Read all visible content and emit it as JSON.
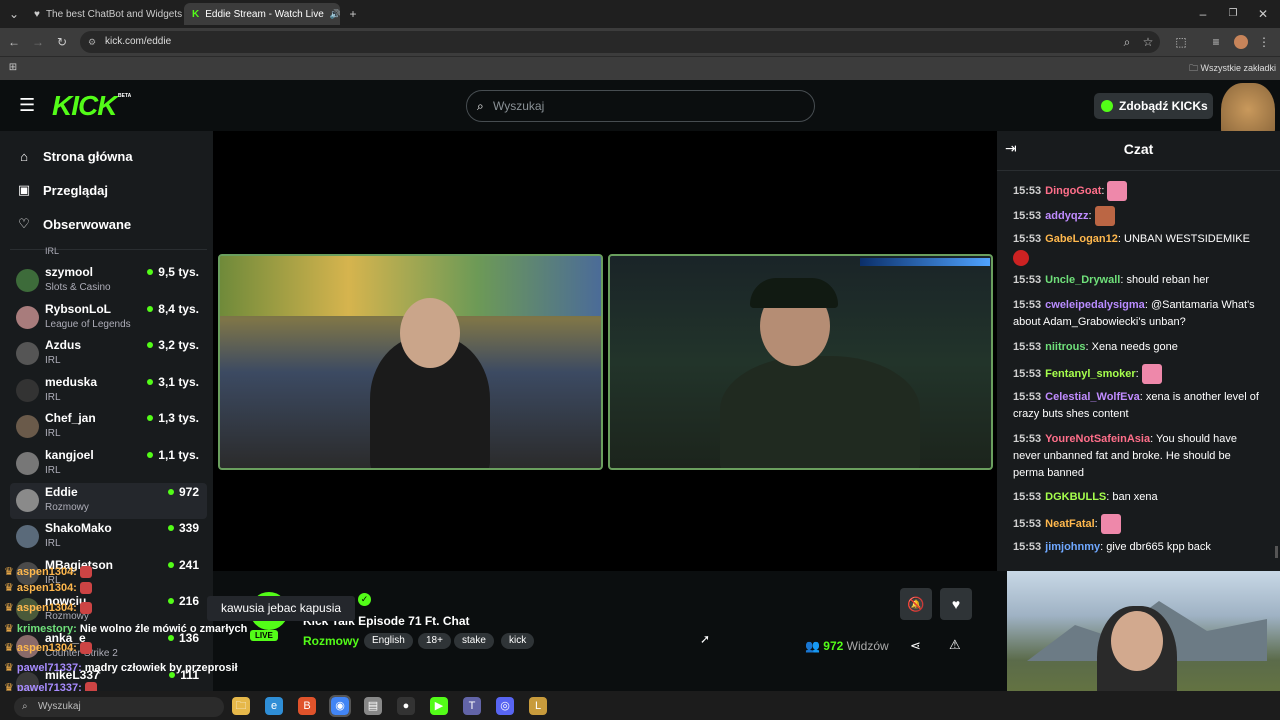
{
  "browser": {
    "tabs": [
      {
        "title": "The best ChatBot and Widgets",
        "active": false
      },
      {
        "title": "Eddie Stream - Watch Live",
        "active": true
      }
    ],
    "url": "kick.com/eddie",
    "bookmarks_label": "Wszystkie zakładki"
  },
  "kick": {
    "logo": "KICK",
    "logo_badge": "BETA",
    "search_placeholder": "Wyszukaj",
    "get_kicks": "Zdobądź KICKs",
    "accent": "#53fc18"
  },
  "nav": [
    {
      "label": "Strona główna",
      "icon": "home-icon"
    },
    {
      "label": "Przeglądaj",
      "icon": "browse-icon"
    },
    {
      "label": "Obserwowane",
      "icon": "heart-icon"
    }
  ],
  "sidebar_cut_label": "IRL",
  "channels": [
    {
      "name": "szymool",
      "category": "Slots & Casino",
      "viewers": "9,5 tys.",
      "color": "#3d6b3a"
    },
    {
      "name": "RybsonLoL",
      "category": "League of Legends",
      "viewers": "8,4 tys.",
      "color": "#a87c7c"
    },
    {
      "name": "Azdus",
      "category": "IRL",
      "viewers": "3,2 tys.",
      "color": "#555"
    },
    {
      "name": "meduska",
      "category": "IRL",
      "viewers": "3,1 tys.",
      "color": "#333"
    },
    {
      "name": "Chef_jan",
      "category": "IRL",
      "viewers": "1,3 tys.",
      "color": "#6a5a4a"
    },
    {
      "name": "kangjoel",
      "category": "IRL",
      "viewers": "1,1 tys.",
      "color": "#777"
    },
    {
      "name": "Eddie",
      "category": "Rozmowy",
      "viewers": "972",
      "color": "#8a8a8a",
      "selected": true
    },
    {
      "name": "ShakoMako",
      "category": "IRL",
      "viewers": "339",
      "color": "#5a6a7a"
    },
    {
      "name": "MBagietson",
      "category": "IRL",
      "viewers": "241",
      "color": "#4a4a4a"
    },
    {
      "name": "nowciu",
      "category": "Rozmowy",
      "viewers": "216",
      "color": "#4a5a3a"
    },
    {
      "name": "anka_e",
      "category": "Counter-Strike 2",
      "viewers": "136",
      "color": "#8a6a6a"
    },
    {
      "name": "mikeL337",
      "category": "",
      "viewers": "111",
      "color": "#3a3a3a"
    }
  ],
  "stream": {
    "title": "Kick Talk Episode 71 Ft. Chat",
    "category": "Rozmowy",
    "tags": [
      "English",
      "18+",
      "stake",
      "kick"
    ],
    "live": "LIVE",
    "viewers": "972",
    "viewers_label": "Widzów",
    "tooltip": "kawusia jebac kapusia"
  },
  "chat": {
    "title": "Czat",
    "messages": [
      {
        "time": "15:53",
        "user": "DingoGoat",
        "color": "#ff6f8a",
        "text": "",
        "emote": "#e8a"
      },
      {
        "time": "15:53",
        "user": "addyqzz",
        "color": "#c08cff",
        "text": "",
        "emote": "#b64"
      },
      {
        "time": "15:53",
        "user": "GabeLogan12",
        "color": "#ffb84d",
        "text": "UNBAN WESTSIDEMIKE",
        "emote": "#c22"
      },
      {
        "time": "15:53",
        "user": "Uncle_Drywall",
        "color": "#6fe07a",
        "text": "should reban her"
      },
      {
        "time": "15:53",
        "user": "cweleipedalysigma",
        "color": "#b98cff",
        "text": "@Santamaria What's about Adam_Grabowiecki's unban?"
      },
      {
        "time": "15:53",
        "user": "niitrous",
        "color": "#6fe07a",
        "text": "Xena needs gone"
      },
      {
        "time": "15:53",
        "user": "Fentanyl_smoker",
        "color": "#a6ff4d",
        "text": "",
        "emote": "#e8a"
      },
      {
        "time": "15:53",
        "user": "Celestial_WolfEva",
        "color": "#c08cff",
        "text": "xena is another level of crazy buts shes content"
      },
      {
        "time": "15:53",
        "user": "YoureNotSafeinAsia",
        "color": "#ff6f8a",
        "text": "You should have never unbanned fat and broke. He should be perma banned"
      },
      {
        "time": "15:53",
        "user": "DGKBULLS",
        "color": "#a6ff4d",
        "text": "ban xena"
      },
      {
        "time": "15:53",
        "user": "NeatFatal",
        "color": "#ffb84d",
        "text": "",
        "emote": "#e8a"
      },
      {
        "time": "15:53",
        "user": "jimjohnmy",
        "color": "#6fa8ff",
        "text": "give dbr665 kpp back"
      }
    ]
  },
  "overlay_chat": [
    {
      "user": "aspen1304:",
      "text": "",
      "color": "#ffb84d"
    },
    {
      "user": "aspen1304:",
      "text": "",
      "color": "#ffb84d"
    },
    {
      "user": "aspen1304:",
      "text": "",
      "color": "#ffb84d"
    },
    {
      "user": "krimestory:",
      "text": "Nie wolno źle mówić o zmarłych",
      "color": "#6fe07a"
    },
    {
      "user": "aspen1304:",
      "text": "",
      "color": "#ffb84d"
    },
    {
      "user": "pawel71337:",
      "text": "mądry człowiek by przeprosił",
      "color": "#a88cff"
    },
    {
      "user": "pawel71337:",
      "text": "",
      "color": "#a88cff"
    },
    {
      "user": "pawel71337:",
      "text": "",
      "color": "#a88cff"
    }
  ],
  "taskbar": {
    "search_placeholder": "Wyszukaj",
    "apps": [
      "file-explorer-icon",
      "edge-icon",
      "brave-icon",
      "chrome-icon",
      "notes-icon",
      "obs-icon",
      "kick-app-icon",
      "teams-icon",
      "discord-icon",
      "league-icon"
    ]
  }
}
